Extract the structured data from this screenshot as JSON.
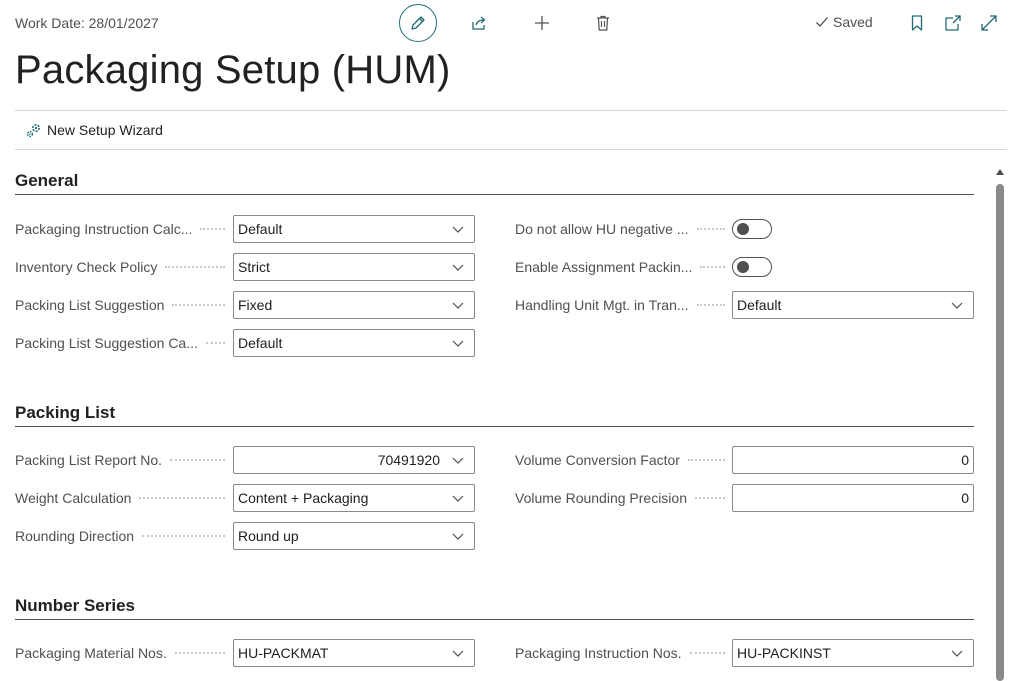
{
  "header": {
    "work_date": "Work Date: 28/01/2027",
    "saved_label": "Saved",
    "title": "Packaging Setup (HUM)"
  },
  "actions": {
    "wizard_label": "New Setup Wizard"
  },
  "sections": {
    "general": {
      "title": "General",
      "left": [
        {
          "label": "Packaging Instruction Calc...",
          "value": "Default"
        },
        {
          "label": "Inventory Check Policy",
          "value": "Strict"
        },
        {
          "label": "Packing List Suggestion",
          "value": "Fixed"
        },
        {
          "label": "Packing List Suggestion Ca...",
          "value": "Default"
        }
      ],
      "right": [
        {
          "label": "Do not allow HU negative ...",
          "toggle": false
        },
        {
          "label": "Enable Assignment Packin...",
          "toggle": false
        },
        {
          "label": "Handling Unit Mgt. in Tran...",
          "value": "Default"
        }
      ]
    },
    "packing_list": {
      "title": "Packing List",
      "left": [
        {
          "label": "Packing List Report No.",
          "value": "70491920"
        },
        {
          "label": "Weight Calculation",
          "value": "Content + Packaging"
        },
        {
          "label": "Rounding Direction",
          "value": "Round up"
        }
      ],
      "right": [
        {
          "label": "Volume Conversion Factor",
          "value": "0"
        },
        {
          "label": "Volume Rounding Precision",
          "value": "0"
        }
      ]
    },
    "number_series": {
      "title": "Number Series",
      "left": [
        {
          "label": "Packaging Material Nos.",
          "value": "HU-PACKMAT"
        }
      ],
      "right": [
        {
          "label": "Packaging Instruction Nos.",
          "value": "HU-PACKINST"
        }
      ]
    }
  },
  "colors": {
    "accent": "#1f6b75",
    "text": "#212121",
    "label": "#505050"
  }
}
